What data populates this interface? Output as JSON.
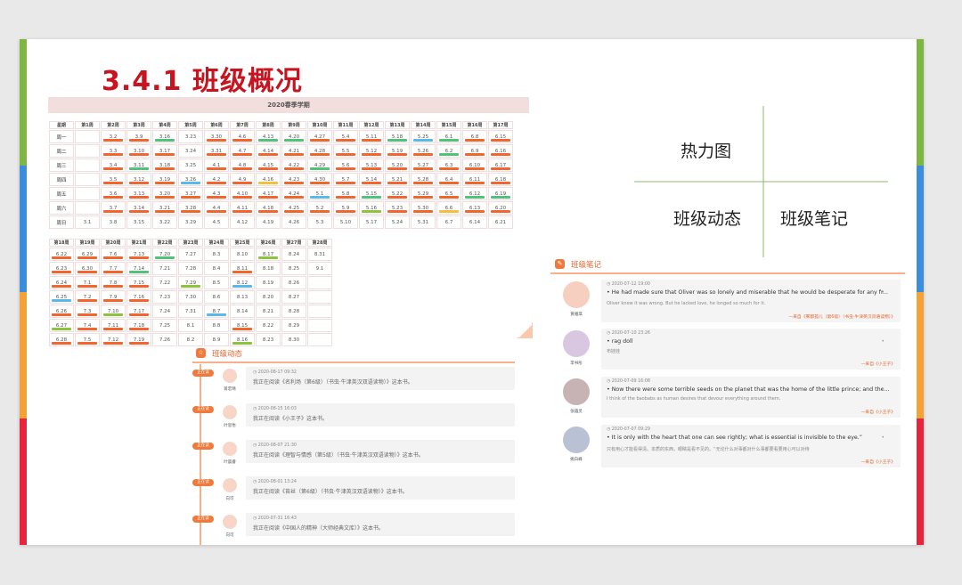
{
  "slide": {
    "title": "3.4.1  班级概况"
  },
  "colors": {
    "accent_left": [
      "#7db742",
      "#3b8ede",
      "#f4a236",
      "#e8243c"
    ],
    "accent_right": [
      "#7db742",
      "#3b8ede",
      "#f4a236",
      "#e8243c"
    ],
    "heat_red": "#f2652e",
    "heat_green": "#52c17a",
    "heat_blue": "#5bb8e8",
    "heat_yellow": "#f2c03a",
    "heat_lime": "#8cc43e",
    "orange": "#f07a3c"
  },
  "heatmap": {
    "semester": "2020春季学期",
    "weeks1": [
      "星期",
      "第1周",
      "第2周",
      "第3周",
      "第4周",
      "第5周",
      "第6周",
      "第7周",
      "第8周",
      "第9周",
      "第10周",
      "第11周",
      "第12周",
      "第13周",
      "第14周",
      "第15周",
      "第16周",
      "第17周"
    ],
    "days": [
      "周一",
      "周二",
      "周三",
      "周四",
      "周五",
      "周六",
      "周日"
    ],
    "rows1": [
      [
        [
          "",
          ""
        ],
        [
          "3.2",
          "red"
        ],
        [
          "3.9",
          "red"
        ],
        [
          "3.16",
          "green"
        ],
        [
          "3.23",
          ""
        ],
        [
          "3.30",
          "red"
        ],
        [
          "4.6",
          "red"
        ],
        [
          "4.13",
          "green"
        ],
        [
          "4.20",
          "green"
        ],
        [
          "4.27",
          "red"
        ],
        [
          "5.4",
          "red"
        ],
        [
          "5.11",
          "red"
        ],
        [
          "5.18",
          "green"
        ],
        [
          "5.25",
          "blue"
        ],
        [
          "6.1",
          "green"
        ],
        [
          "6.8",
          "red"
        ],
        [
          "6.15",
          "red"
        ]
      ],
      [
        [
          "",
          ""
        ],
        [
          "3.3",
          "red"
        ],
        [
          "3.10",
          "red"
        ],
        [
          "3.17",
          "red"
        ],
        [
          "3.24",
          ""
        ],
        [
          "3.31",
          "red"
        ],
        [
          "4.7",
          "red"
        ],
        [
          "4.14",
          "red"
        ],
        [
          "4.21",
          "red"
        ],
        [
          "4.28",
          "red"
        ],
        [
          "5.5",
          "red"
        ],
        [
          "5.12",
          "red"
        ],
        [
          "5.19",
          "red"
        ],
        [
          "5.26",
          "red"
        ],
        [
          "6.2",
          "green"
        ],
        [
          "6.9",
          "red"
        ],
        [
          "6.16",
          "red"
        ]
      ],
      [
        [
          "",
          ""
        ],
        [
          "3.4",
          "red"
        ],
        [
          "3.11",
          "green"
        ],
        [
          "3.18",
          "red"
        ],
        [
          "3.25",
          ""
        ],
        [
          "4.1",
          "red"
        ],
        [
          "4.8",
          "red"
        ],
        [
          "4.15",
          "red"
        ],
        [
          "4.22",
          "red"
        ],
        [
          "4.29",
          "green"
        ],
        [
          "5.6",
          "red"
        ],
        [
          "5.13",
          "red"
        ],
        [
          "5.20",
          "red"
        ],
        [
          "5.27",
          "red"
        ],
        [
          "6.3",
          "red"
        ],
        [
          "6.10",
          "red"
        ],
        [
          "6.17",
          "red"
        ]
      ],
      [
        [
          "",
          ""
        ],
        [
          "3.5",
          "red"
        ],
        [
          "3.12",
          "red"
        ],
        [
          "3.19",
          "red"
        ],
        [
          "3.26",
          "blue"
        ],
        [
          "4.2",
          "red"
        ],
        [
          "4.9",
          "red"
        ],
        [
          "4.16",
          "yellow"
        ],
        [
          "4.23",
          "red"
        ],
        [
          "4.30",
          "red"
        ],
        [
          "5.7",
          "red"
        ],
        [
          "5.14",
          "red"
        ],
        [
          "5.21",
          "red"
        ],
        [
          "5.28",
          "red"
        ],
        [
          "6.4",
          "red"
        ],
        [
          "6.11",
          "red"
        ],
        [
          "6.18",
          "red"
        ]
      ],
      [
        [
          "",
          ""
        ],
        [
          "3.6",
          "red"
        ],
        [
          "3.13",
          "red"
        ],
        [
          "3.20",
          "red"
        ],
        [
          "3.27",
          "red"
        ],
        [
          "4.3",
          "red"
        ],
        [
          "4.10",
          "red"
        ],
        [
          "4.17",
          "red"
        ],
        [
          "4.24",
          "red"
        ],
        [
          "5.1",
          "blue"
        ],
        [
          "5.8",
          "red"
        ],
        [
          "5.15",
          "green"
        ],
        [
          "5.22",
          "red"
        ],
        [
          "5.29",
          "red"
        ],
        [
          "6.5",
          "red"
        ],
        [
          "6.12",
          "green"
        ],
        [
          "6.19",
          "green"
        ]
      ],
      [
        [
          "",
          ""
        ],
        [
          "3.7",
          "red"
        ],
        [
          "3.14",
          "red"
        ],
        [
          "3.21",
          "red"
        ],
        [
          "3.28",
          "red"
        ],
        [
          "4.4",
          "red"
        ],
        [
          "4.11",
          "red"
        ],
        [
          "4.18",
          "red"
        ],
        [
          "4.25",
          "red"
        ],
        [
          "5.2",
          "red"
        ],
        [
          "5.9",
          "red"
        ],
        [
          "5.16",
          "lime"
        ],
        [
          "5.23",
          "red"
        ],
        [
          "5.30",
          "red"
        ],
        [
          "6.6",
          "yellow"
        ],
        [
          "6.13",
          "red"
        ],
        [
          "6.20",
          "red"
        ]
      ],
      [
        [
          "3.1",
          ""
        ],
        [
          "3.8",
          ""
        ],
        [
          "3.15",
          ""
        ],
        [
          "3.22",
          ""
        ],
        [
          "3.29",
          ""
        ],
        [
          "4.5",
          ""
        ],
        [
          "4.12",
          ""
        ],
        [
          "4.19",
          ""
        ],
        [
          "4.26",
          ""
        ],
        [
          "5.3",
          ""
        ],
        [
          "5.10",
          ""
        ],
        [
          "5.17",
          ""
        ],
        [
          "5.24",
          ""
        ],
        [
          "5.31",
          ""
        ],
        [
          "6.7",
          ""
        ],
        [
          "6.14",
          ""
        ],
        [
          "6.21",
          ""
        ]
      ]
    ],
    "weeks2": [
      "第18周",
      "第19周",
      "第20周",
      "第21周",
      "第22周",
      "第23周",
      "第24周",
      "第25周",
      "第26周",
      "第27周",
      "第28周"
    ],
    "rows2": [
      [
        [
          "6.22",
          "red"
        ],
        [
          "6.29",
          "red"
        ],
        [
          "7.6",
          "red"
        ],
        [
          "7.13",
          "red"
        ],
        [
          "7.20",
          "green"
        ],
        [
          "7.27",
          ""
        ],
        [
          "8.3",
          ""
        ],
        [
          "8.10",
          ""
        ],
        [
          "8.17",
          "lime"
        ],
        [
          "8.24",
          ""
        ],
        [
          "8.31",
          ""
        ]
      ],
      [
        [
          "6.23",
          "red"
        ],
        [
          "6.30",
          "red"
        ],
        [
          "7.7",
          "red"
        ],
        [
          "7.14",
          "green"
        ],
        [
          "7.21",
          ""
        ],
        [
          "7.28",
          ""
        ],
        [
          "8.4",
          ""
        ],
        [
          "8.11",
          "red"
        ],
        [
          "8.18",
          ""
        ],
        [
          "8.25",
          ""
        ],
        [
          "9.1",
          ""
        ]
      ],
      [
        [
          "6.24",
          "red"
        ],
        [
          "7.1",
          "red"
        ],
        [
          "7.8",
          "red"
        ],
        [
          "7.15",
          "red"
        ],
        [
          "7.22",
          ""
        ],
        [
          "7.29",
          "lime"
        ],
        [
          "8.5",
          ""
        ],
        [
          "8.12",
          "blue"
        ],
        [
          "8.19",
          ""
        ],
        [
          "8.26",
          ""
        ],
        [
          "",
          ""
        ]
      ],
      [
        [
          "6.25",
          "blue"
        ],
        [
          "7.2",
          "red"
        ],
        [
          "7.9",
          "red"
        ],
        [
          "7.16",
          "red"
        ],
        [
          "7.23",
          ""
        ],
        [
          "7.30",
          ""
        ],
        [
          "8.6",
          ""
        ],
        [
          "8.13",
          ""
        ],
        [
          "8.20",
          ""
        ],
        [
          "8.27",
          ""
        ],
        [
          "",
          ""
        ]
      ],
      [
        [
          "6.26",
          "red"
        ],
        [
          "7.3",
          "red"
        ],
        [
          "7.10",
          "lime"
        ],
        [
          "7.17",
          "red"
        ],
        [
          "7.24",
          ""
        ],
        [
          "7.31",
          ""
        ],
        [
          "8.7",
          "blue"
        ],
        [
          "8.14",
          ""
        ],
        [
          "8.21",
          ""
        ],
        [
          "8.28",
          ""
        ],
        [
          "",
          ""
        ]
      ],
      [
        [
          "6.27",
          "lime"
        ],
        [
          "7.4",
          "red"
        ],
        [
          "7.11",
          "red"
        ],
        [
          "7.18",
          "red"
        ],
        [
          "7.25",
          ""
        ],
        [
          "8.1",
          ""
        ],
        [
          "8.8",
          ""
        ],
        [
          "8.15",
          "red"
        ],
        [
          "8.22",
          ""
        ],
        [
          "8.29",
          ""
        ],
        [
          "",
          ""
        ]
      ],
      [
        [
          "6.28",
          "red"
        ],
        [
          "7.5",
          "red"
        ],
        [
          "7.12",
          "red"
        ],
        [
          "7.19",
          "red"
        ],
        [
          "7.26",
          ""
        ],
        [
          "8.2",
          ""
        ],
        [
          "8.9",
          ""
        ],
        [
          "8.16",
          "lime"
        ],
        [
          "8.23",
          ""
        ],
        [
          "8.30",
          ""
        ],
        [
          "",
          ""
        ]
      ]
    ]
  },
  "diagram": {
    "top_left": "热力图",
    "bottom_left": "班级动态",
    "bottom_right": "班级笔记"
  },
  "dynamics": {
    "title": "班级动态",
    "icon": "star-icon",
    "items": [
      {
        "tag": "正在读",
        "name": "蒋宏晴",
        "time": "2020-08-17 09:32",
        "text": "我正在阅读《名利场（第6级）（书虫·牛津英汉双语读物）》这本书。"
      },
      {
        "tag": "正在读",
        "name": "叶思怡",
        "time": "2020-08-15 16:03",
        "text": "我正在阅读《小王子》这本书。"
      },
      {
        "tag": "正在读",
        "name": "叶晨睿",
        "time": "2020-08-07 21:30",
        "text": "我正在阅读《理智与情感（第5级）（书虫·牛津英汉双语读物）》这本书。"
      },
      {
        "tag": "正在读",
        "name": "向可",
        "time": "2020-08-01 13:24",
        "text": "我正在阅读《苔丝（第6级）（书虫·牛津英汉双语读物）》这本书。"
      },
      {
        "tag": "正在读",
        "name": "向可",
        "time": "2020-07-31 16:43",
        "text": "我正在阅读《中国人的精神（大师经典文库）》这本书。"
      }
    ]
  },
  "notes": {
    "title": "班级笔记",
    "items": [
      {
        "name": "黄雅琪",
        "time": "2020-07-12 19:00",
        "quote": "He had made sure that Oliver was so lonely and miserable that he would be desperate for any fr...",
        "sub": "Oliver knew it was wrong. But he lacked love, he longed so much for it.",
        "source": "—来自《雾都孤儿（第6级）（书虫·牛津英汉双语读物）》",
        "avatar": "#f7cfc0"
      },
      {
        "name": "李书彤",
        "time": "2020-07-10 23:26",
        "quote": "rag doll",
        "sub": "布娃娃",
        "source": "—来自《小王子》",
        "avatar": "#d9c6e0"
      },
      {
        "name": "张蕴灵",
        "time": "2020-07-09 16:08",
        "quote": "Now there were some terrible seeds on the planet that was the home of the little prince; and the...",
        "sub": "I think of the baobabs as human desires that devour everything around them.",
        "source": "—来自《小王子》",
        "avatar": "#c7b3b3"
      },
      {
        "name": "姚白峰",
        "time": "2020-07-07 09:29",
        "quote": "It is only with the heart that one can see rightly; what is essential is invisible to the eye.”",
        "sub": "只有用心才能看得清。本质的东西，眼睛是看不见的。“无论什么对事都对什么事都要看要用心可以对待",
        "source": "—来自《小王子》",
        "avatar": "#b9c2d4"
      }
    ]
  }
}
